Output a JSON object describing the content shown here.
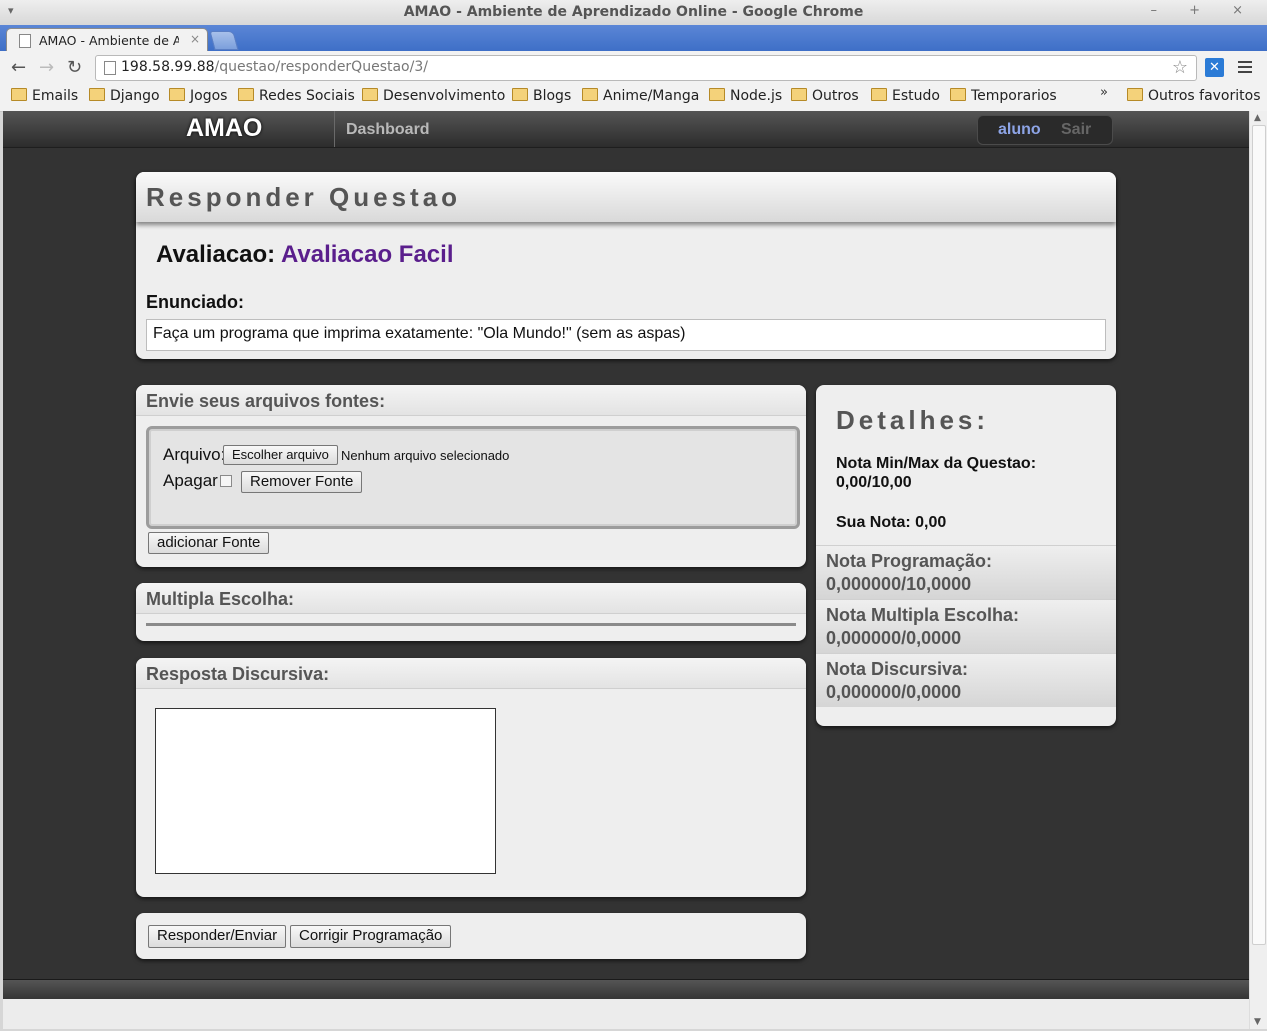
{
  "window": {
    "title": "AMAO - Ambiente de Aprendizado Online - Google Chrome",
    "menu_glyph": "▾",
    "controls": "– + ×"
  },
  "tab": {
    "label": "AMAO - Ambiente de Ap",
    "close": "×"
  },
  "toolbar": {
    "back": "←",
    "forward": "→",
    "reload": "↻",
    "url_host": "198.58.99.88",
    "url_path": "/questao/responderQuestao/3/",
    "star": "☆",
    "extension": "✕"
  },
  "bookmarks": {
    "items": [
      "Emails",
      "Django",
      "Jogos",
      "Redes Sociais",
      "Desenvolvimento",
      "Blogs",
      "Anime/Manga",
      "Node.js",
      "Outros",
      "Estudo",
      "Temporarios"
    ],
    "more": "»",
    "other": "Outros favoritos"
  },
  "nav": {
    "brand": "AMAO",
    "dashboard": "Dashboard",
    "user": "aluno",
    "logout": "Sair"
  },
  "responder": {
    "title": "Responder Questao",
    "avaliacao_label": "Avaliacao:",
    "avaliacao_name": "Avaliacao Facil",
    "enunciado_label": "Enunciado:",
    "enunciado_text": "Faça um programa que imprima exatamente: \"Ola Mundo!\" (sem as aspas)"
  },
  "fontes": {
    "title": "Envie seus arquivos fontes:",
    "arquivo_label": "Arquivo:",
    "choose_button": "Escolher arquivo",
    "no_file": "Nenhum arquivo selecionado",
    "apagar_label": "Apagar",
    "apagar_checked": false,
    "remove_button": "Remover Fonte",
    "add_button": "adicionar Fonte"
  },
  "multipla": {
    "title": "Multipla Escolha:"
  },
  "discursiva": {
    "title": "Resposta Discursiva:",
    "value": ""
  },
  "actions": {
    "send_button": "Responder/Enviar",
    "fix_button": "Corrigir Programação"
  },
  "detalhes": {
    "title": "Detalhes:",
    "minmax_label": "Nota Min/Max da Questao:",
    "minmax_value": "0,00/10,00",
    "sua_nota": "Sua Nota: 0,00",
    "items": [
      {
        "label": "Nota Programação:",
        "value": "0,000000/10,0000"
      },
      {
        "label": "Nota Multipla Escolha:",
        "value": "0,000000/0,0000"
      },
      {
        "label": "Nota Discursiva:",
        "value": "0,000000/0,0000"
      }
    ]
  },
  "colors": {
    "page_bg": "#333333",
    "panel_bg": "#eeeeee",
    "avaliacao_name": "#5a1e8c",
    "user_link": "#8da4e6",
    "tab_strip": "#3e6fc7"
  }
}
